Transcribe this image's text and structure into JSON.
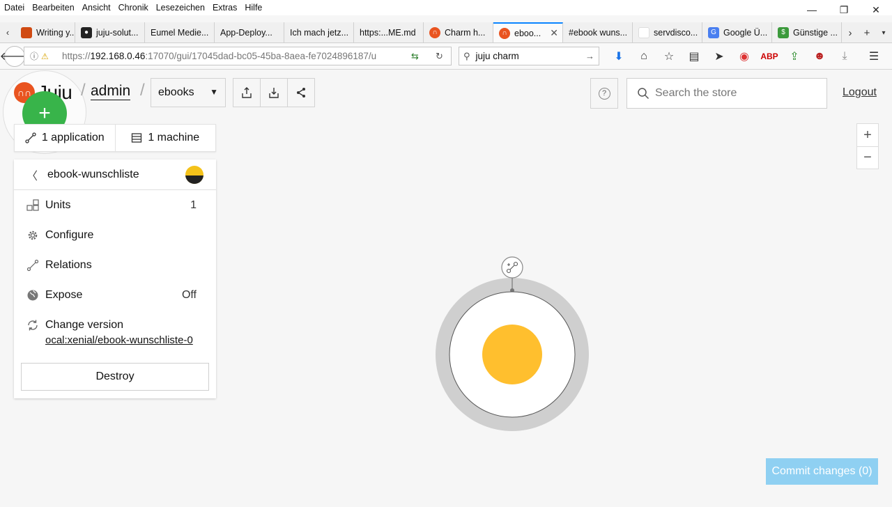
{
  "browser": {
    "menu": [
      "Datei",
      "Bearbeiten",
      "Ansicht",
      "Chronik",
      "Lesezeichen",
      "Extras",
      "Hilfe"
    ],
    "tabs": [
      {
        "label": "Writing y...",
        "fav_color": "#d04a12"
      },
      {
        "label": "juju-solut...",
        "fav_color": "#222222"
      },
      {
        "label": "Eumel Medie...",
        "fav_color": ""
      },
      {
        "label": "App-Deploy...",
        "fav_color": ""
      },
      {
        "label": "Ich mach jetz...",
        "fav_color": ""
      },
      {
        "label": "https:...ME.md",
        "fav_color": ""
      },
      {
        "label": "Charm h...",
        "fav_color": "#e95420"
      },
      {
        "label": "eboo...",
        "fav_color": "#e95420",
        "active": true
      },
      {
        "label": "#ebook wuns...",
        "fav_color": ""
      },
      {
        "label": "servdisco...",
        "fav_color": "#ffffff"
      },
      {
        "label": "Google Ü...",
        "fav_color": "#4a7ff0"
      },
      {
        "label": "Günstige ...",
        "fav_color": "#3c9a3c"
      }
    ],
    "url_prefix": "https://",
    "url_host": "192.168.0.46",
    "url_rest": ":17070/gui/17045dad-bc05-45ba-8aea-fe7024896187/u",
    "search_value": "juju charm"
  },
  "header": {
    "logo_text": "Juju",
    "user": "admin",
    "model": "ebooks",
    "store_placeholder": "Search the store",
    "logout": "Logout"
  },
  "counts": {
    "applications": "1 application",
    "machines": "1 machine"
  },
  "inspector": {
    "title": "ebook-wunschliste",
    "rows": {
      "units_label": "Units",
      "units_value": "1",
      "configure_label": "Configure",
      "relations_label": "Relations",
      "expose_label": "Expose",
      "expose_value": "Off",
      "change_version_label": "Change version",
      "charm_url": "ocal:xenial/ebook-wunschliste-0"
    },
    "destroy": "Destroy"
  },
  "canvas": {
    "commit": "Commit changes (0)",
    "zoom_in": "+",
    "zoom_out": "−",
    "service_color": "#ffbf2e"
  }
}
